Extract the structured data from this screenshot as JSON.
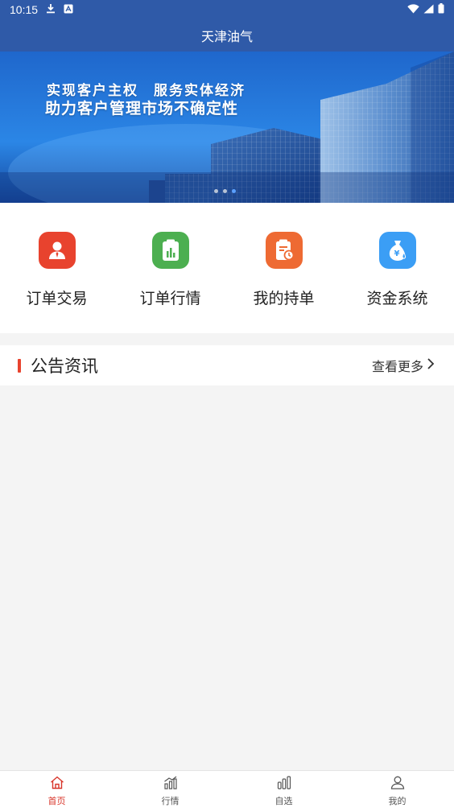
{
  "status_bar": {
    "time": "10:15"
  },
  "header": {
    "title": "天津油气"
  },
  "banner": {
    "line1": "实现客户主权　服务实体经济",
    "line2": "助力客户管理市场不确定性"
  },
  "menu": {
    "items": [
      {
        "label": "订单交易",
        "icon": "user-icon",
        "color": "#e8432e"
      },
      {
        "label": "订单行情",
        "icon": "chart-clipboard-icon",
        "color": "#4caf50"
      },
      {
        "label": "我的持单",
        "icon": "clipboard-clock-icon",
        "color": "#ee6a33"
      },
      {
        "label": "资金系统",
        "icon": "money-bag-icon",
        "color": "#3b9ef5"
      }
    ]
  },
  "notice": {
    "title": "公告资讯",
    "more": "查看更多"
  },
  "tabs": [
    {
      "label": "首页",
      "icon": "home-icon",
      "active": true
    },
    {
      "label": "行情",
      "icon": "market-chart-icon",
      "active": false
    },
    {
      "label": "自选",
      "icon": "bars-icon",
      "active": false
    },
    {
      "label": "我的",
      "icon": "person-icon",
      "active": false
    }
  ],
  "colors": {
    "header": "#2f5aa8",
    "accent": "#d8352a",
    "notice_bar": "#e8432e"
  }
}
